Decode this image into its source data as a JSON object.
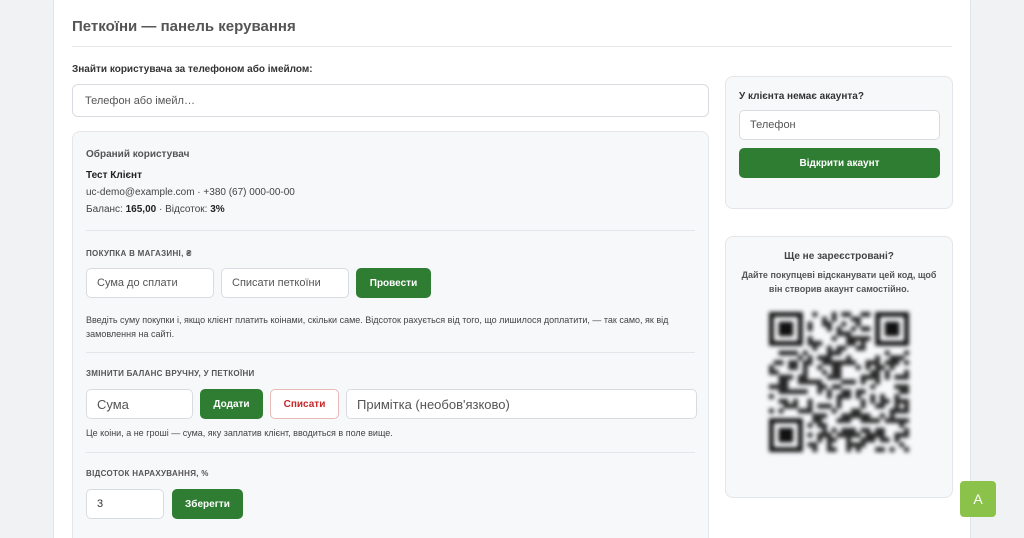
{
  "header": {
    "title": "Петкоїни — панель керування"
  },
  "search": {
    "label": "Знайти користувача за телефоном або імейлом:",
    "placeholder": "Телефон або імейл…"
  },
  "user": {
    "section_title": "Обраний користувач",
    "name": "Тест Клієнт",
    "contacts": "uc-demo@example.com · +380 (67) 000-00-00",
    "balance_label": "Баланс: ",
    "balance_value": "165,00",
    "separator": " · Відсоток: ",
    "percent_value": "3%"
  },
  "purchase": {
    "label": "Покупка в магазині, ₴",
    "amount_placeholder": "Сума до сплати",
    "coins_placeholder": "Списати петкоїни",
    "submit_label": "Провести",
    "hint": "Введіть суму покупки і, якщо клієнт платить коінами, скільки саме. Відсоток рахується від того, що лишилося доплатити, — так само, як від замовлення на сайті."
  },
  "manual_balance": {
    "label": "Змінити баланс вручну, у петкоїни",
    "amount_placeholder": "Сума",
    "add_label": "Додати",
    "subtract_label": "Списати",
    "note_placeholder": "Примітка (необов'язково)",
    "hint": "Це коіни, а не гроші — сума, яку заплатив клієнт, вводиться в поле вище."
  },
  "accrual": {
    "label": "Відсоток нарахування, %",
    "value": "3",
    "save_label": "Зберегти"
  },
  "no_account": {
    "title": "У клієнта немає акаунта?",
    "phone_placeholder": "Телефон",
    "open_label": "Відкрити акаунт"
  },
  "not_registered": {
    "title": "Ще не зареєстровані?",
    "text": "Дайте покупцеві відсканувати цей код, щоб він створив акаунт самостійно."
  },
  "fab": {
    "label": "A"
  },
  "colors": {
    "accent": "#2e7d32",
    "danger": "#c62828",
    "fab": "#8bc34a"
  }
}
